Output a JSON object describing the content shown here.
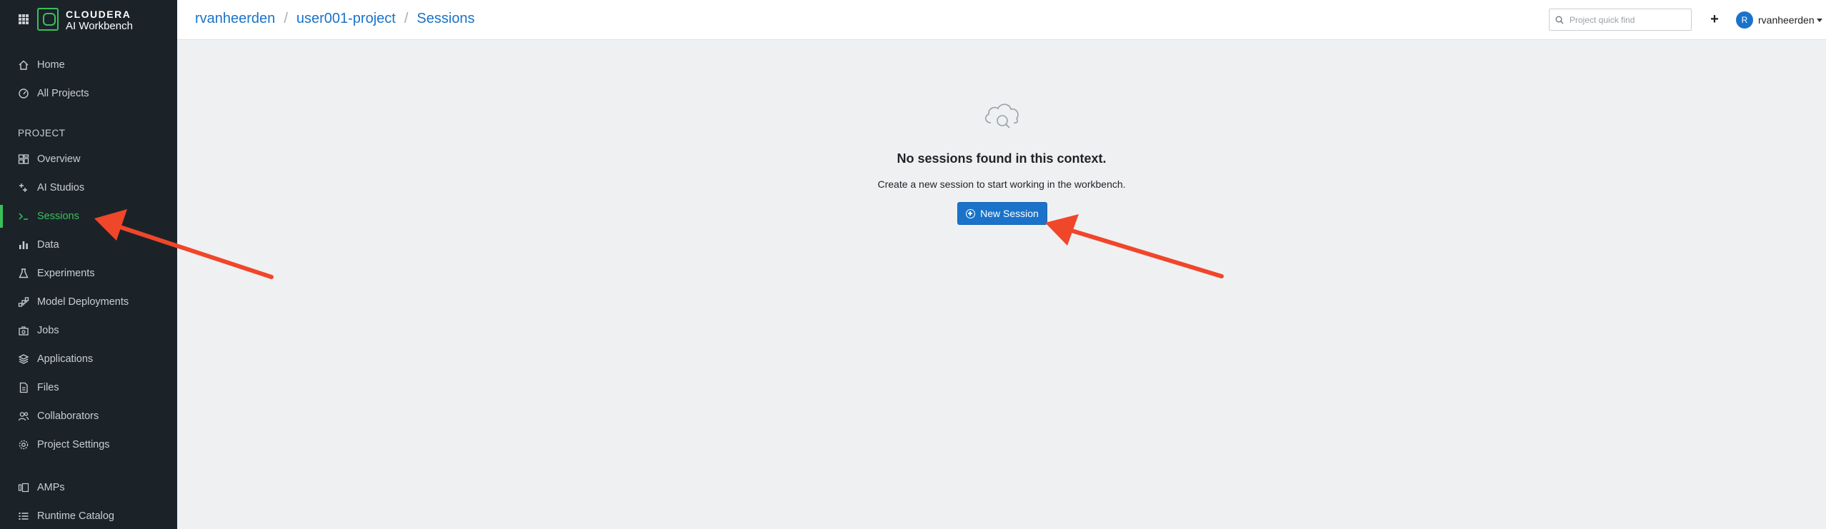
{
  "brand": {
    "line1": "CLOUDERA",
    "line2": "AI Workbench"
  },
  "sidebar": {
    "top_items": [
      {
        "label": "Home",
        "icon": "home-icon"
      },
      {
        "label": "All Projects",
        "icon": "gauge-icon"
      }
    ],
    "section_label": "PROJECT",
    "project_items": [
      {
        "label": "Overview",
        "icon": "overview-icon"
      },
      {
        "label": "AI Studios",
        "icon": "sparkle-icon"
      },
      {
        "label": "Sessions",
        "icon": "terminal-icon",
        "active": true
      },
      {
        "label": "Data",
        "icon": "bar-chart-icon"
      },
      {
        "label": "Experiments",
        "icon": "flask-icon"
      },
      {
        "label": "Model Deployments",
        "icon": "model-icon"
      },
      {
        "label": "Jobs",
        "icon": "jobs-icon"
      },
      {
        "label": "Applications",
        "icon": "layers-icon"
      },
      {
        "label": "Files",
        "icon": "file-icon"
      },
      {
        "label": "Collaborators",
        "icon": "users-icon"
      },
      {
        "label": "Project Settings",
        "icon": "gear-icon"
      }
    ],
    "bottom_items": [
      {
        "label": "AMPs",
        "icon": "amps-icon"
      },
      {
        "label": "Runtime Catalog",
        "icon": "list-icon"
      }
    ]
  },
  "header": {
    "breadcrumb": [
      "rvanheerden",
      "user001-project",
      "Sessions"
    ],
    "search_placeholder": "Project quick find",
    "plus_label": "+",
    "user": {
      "initial": "R",
      "name": "rvanheerden"
    }
  },
  "empty_state": {
    "icon": "cloud-search-icon",
    "title": "No sessions found in this context.",
    "subtitle": "Create a new session to start working in the workbench.",
    "button_label": "New Session"
  },
  "colors": {
    "sidebar_bg": "#1b2329",
    "accent_green": "#3bbf5c",
    "link_blue": "#1a73c9",
    "annotation_arrow": "#f0462a"
  }
}
